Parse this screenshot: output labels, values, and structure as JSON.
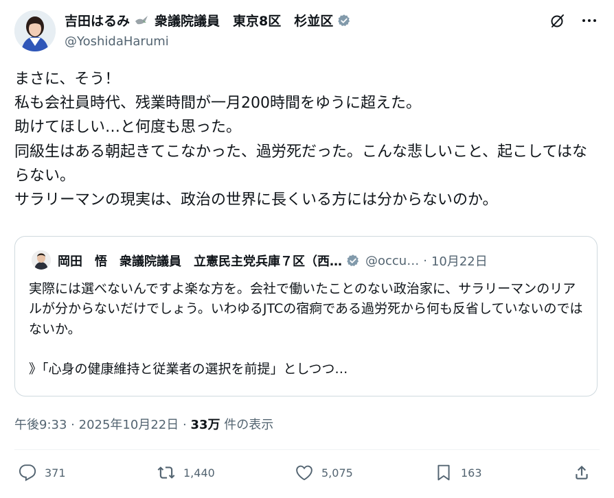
{
  "author": {
    "name_part1": "吉田はるみ",
    "name_part2": "衆議院議員　東京8区　杉並区",
    "handle": "@YoshidaHarumi"
  },
  "post": {
    "text": "まさに、そう！\n私も会社員時代、残業時間が一月200時間をゆうに超えた。\n助けてほしい…と何度も思った。\n同級生はある朝起きてこなかった、過労死だった。こんな悲しいこと、起こしてはならない。\nサラリーマンの現実は、政治の世界に長くいる方には分からないのか。"
  },
  "quote": {
    "name": "岡田　悟　衆議院議員　立憲民主党兵庫７区（西…",
    "handle": "@occu…",
    "separator": "·",
    "date": "10月22日",
    "text": "実際には選べないんですよ楽な方を。会社で働いたことのない政治家に、サラリーマンのリアルが分からないだけでしょう。いわゆるJTCの宿痾である過労死から何も反省していないのではないか。\n\n》「心身の健康維持と従業者の選択を前提」としつつ…"
  },
  "meta": {
    "time": "午後9:33",
    "dot1": "·",
    "date": "2025年10月22日",
    "dot2": "·",
    "views": "33万",
    "views_label": " 件の表示"
  },
  "actions": {
    "replies": "371",
    "reposts": "1,440",
    "likes": "5,075",
    "bookmarks": "163"
  },
  "icons": [
    "grok-icon",
    "more-icon",
    "reply-icon",
    "repost-icon",
    "like-icon",
    "bookmark-icon",
    "share-icon",
    "verified-icon",
    "dove-icon"
  ],
  "colors": {
    "text": "#0f1419",
    "secondary": "#536471",
    "border": "#cfd9de",
    "verified": "#829aab"
  }
}
